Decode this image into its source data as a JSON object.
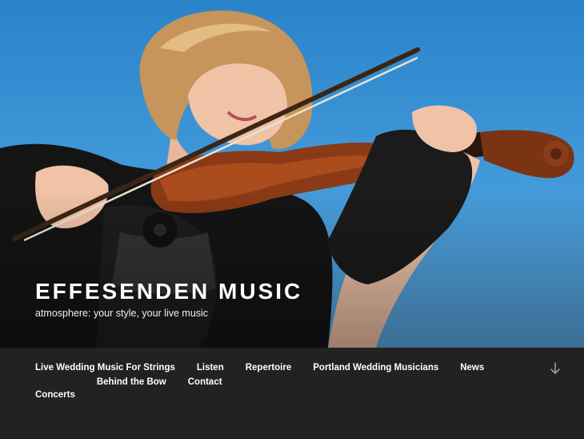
{
  "site": {
    "title": "EFFESENDEN MUSIC",
    "tagline": "atmosphere: your style, your live music"
  },
  "nav": {
    "items": [
      {
        "label": "Live Wedding Music For Strings"
      },
      {
        "label": "Listen"
      },
      {
        "label": "Repertoire"
      },
      {
        "label": "Portland Wedding Musicians"
      },
      {
        "label": "News"
      },
      {
        "label": "Concerts"
      },
      {
        "label": "Behind the Bow"
      },
      {
        "label": "Contact"
      }
    ],
    "scroll_icon": "arrow-down-icon"
  },
  "hero": {
    "image": "violinist-photo"
  },
  "colors": {
    "sky": "#3f97d8",
    "nav_bg": "#222222",
    "text": "#ffffff"
  }
}
